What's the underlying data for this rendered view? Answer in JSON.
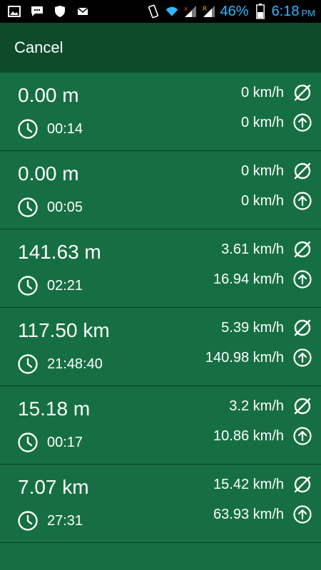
{
  "status_bar": {
    "battery_percent": "46%",
    "time": "6:18",
    "ampm": "PM",
    "icons_left": [
      "image-icon",
      "chat-icon",
      "shield-icon",
      "mail-icon"
    ],
    "icons_right": [
      "vibrate-icon",
      "wifi-icon",
      "signal-x-icon",
      "signal-r-icon",
      "battery-icon"
    ]
  },
  "app_bar": {
    "cancel_label": "Cancel"
  },
  "icons": {
    "avg_speed": "average-speed-icon",
    "max_speed": "max-speed-icon",
    "duration": "clock-icon"
  },
  "trips": [
    {
      "distance": "0.00 m",
      "duration": "00:14",
      "avg_speed": "0 km/h",
      "max_speed": "0 km/h"
    },
    {
      "distance": "0.00 m",
      "duration": "00:05",
      "avg_speed": "0 km/h",
      "max_speed": "0 km/h"
    },
    {
      "distance": "141.63 m",
      "duration": "02:21",
      "avg_speed": "3.61 km/h",
      "max_speed": "16.94 km/h"
    },
    {
      "distance": "117.50 km",
      "duration": "21:48:40",
      "avg_speed": "5.39 km/h",
      "max_speed": "140.98 km/h"
    },
    {
      "distance": "15.18 m",
      "duration": "00:17",
      "avg_speed": "3.2 km/h",
      "max_speed": "10.86 km/h"
    },
    {
      "distance": "7.07 km",
      "duration": "27:31",
      "avg_speed": "15.42 km/h",
      "max_speed": "63.93 km/h"
    }
  ]
}
